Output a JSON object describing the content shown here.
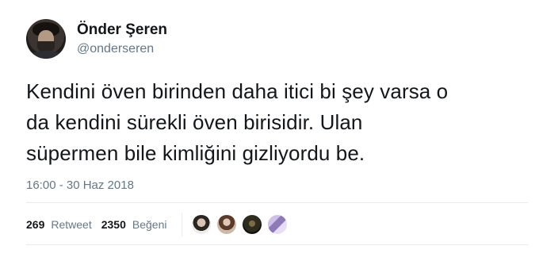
{
  "user": {
    "display_name": "Önder Şeren",
    "handle": "@onderseren"
  },
  "tweet": {
    "lines": [
      "Kendini öven birinden daha itici bi şey varsa o",
      "da kendini sürekli öven birisidir. Ulan",
      "süpermen bile kimliğini gizliyordu be."
    ],
    "timestamp": "16:00 - 30 Haz 2018"
  },
  "stats": {
    "retweet_count": "269",
    "retweet_label": "Retweet",
    "like_count": "2350",
    "like_label": "Beğeni"
  },
  "colors": {
    "text_primary": "#14171a",
    "text_secondary": "#657786",
    "divider": "#e6ecf0"
  }
}
